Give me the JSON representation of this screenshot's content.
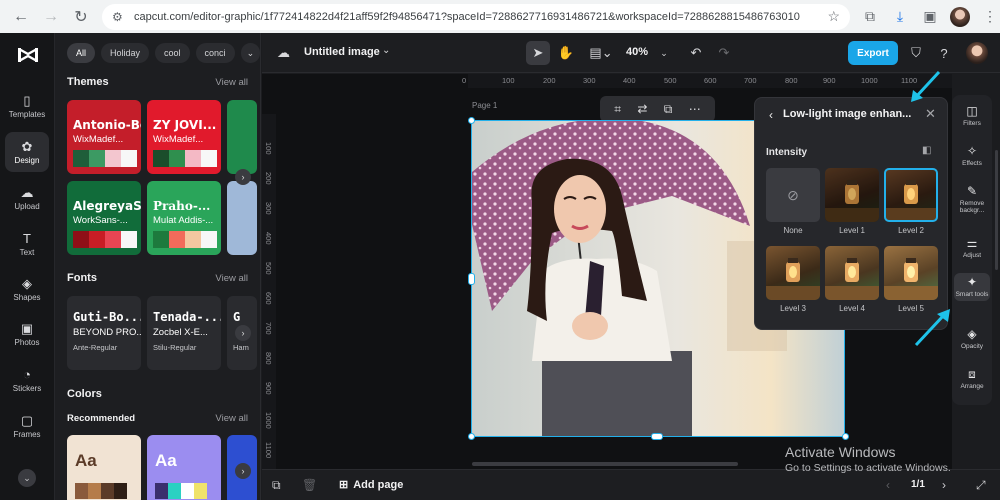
{
  "browser": {
    "url": "capcut.com/editor-graphic/1f772414822d4f21aff59f2f94856471?spaceId=7288627716931486721&workspaceId=7288628815486763010"
  },
  "left_rail": {
    "items": [
      {
        "label": "Templates",
        "icon": "templates-icon"
      },
      {
        "label": "Design",
        "icon": "design-icon"
      },
      {
        "label": "Upload",
        "icon": "upload-icon"
      },
      {
        "label": "Text",
        "icon": "text-icon"
      },
      {
        "label": "Shapes",
        "icon": "shapes-icon"
      },
      {
        "label": "Photos",
        "icon": "photos-icon"
      },
      {
        "label": "Stickers",
        "icon": "stickers-icon"
      },
      {
        "label": "Frames",
        "icon": "frames-icon"
      }
    ],
    "active": "Design"
  },
  "panel": {
    "chips": [
      "All",
      "Holiday",
      "cool",
      "conci"
    ],
    "themes": {
      "title": "Themes",
      "view_all": "View all",
      "cards": [
        {
          "t1": "Antonio-Bold",
          "t2": "WixMadef...",
          "bg": "#c41e2a",
          "swatches": [
            "#1f5e3a",
            "#3c9a63",
            "#f3c6cf",
            "#f7f7f7"
          ]
        },
        {
          "t1": "ZY JOVI...",
          "t2": "WixMadef...",
          "bg": "#e11a2c",
          "swatches": [
            "#1b4d2b",
            "#2f8f4e",
            "#f4b9c5",
            "#f7f7f7"
          ]
        },
        {
          "t1": "AlegreyaS...",
          "t2": "WorkSans-...",
          "bg": "#116c3a",
          "swatches": [
            "#8f0f17",
            "#c81d25",
            "#e84553",
            "#f7f7f7"
          ]
        },
        {
          "t1": "Praho-...",
          "t2": "Mulat Addis-...",
          "bg": "#2aa55a",
          "swatches": [
            "#1d7a3d",
            "#f26b5b",
            "#f4c7a0",
            "#f7f7f7"
          ]
        }
      ]
    },
    "fonts": {
      "title": "Fonts",
      "view_all": "View all",
      "cards": [
        {
          "f1": "Guti-Bo...",
          "f2": "BEYOND PRO...",
          "f3": "Ante-Regular"
        },
        {
          "f1": "Tenada-...",
          "f2": "Zocbel X-E...",
          "f3": "Stilu-Regular"
        },
        {
          "f1": "G",
          "f2": "",
          "f3": "Ham"
        }
      ]
    },
    "colors": {
      "title": "Colors",
      "recommended": "Recommended",
      "view_all": "View all",
      "cards": [
        {
          "aa": "Aa",
          "bg": "#f1e3d3",
          "fg": "#5b3b28",
          "swatches": [
            "#8a5a3c",
            "#b57c4a",
            "#5b3b28",
            "#2e1e15"
          ]
        },
        {
          "aa": "Aa",
          "bg": "#9b8df0",
          "fg": "#ffffff",
          "swatches": [
            "#3a2f6d",
            "#2ad1c2",
            "#ffffff",
            "#f0e36a"
          ]
        }
      ]
    }
  },
  "topbar": {
    "title": "Untitled image",
    "zoom": "40%",
    "export": "Export"
  },
  "canvas": {
    "page_label": "Page 1",
    "ruler_top": [
      "100",
      "200",
      "300",
      "400",
      "500",
      "600",
      "700",
      "800",
      "900",
      "1000",
      "1100"
    ],
    "ruler_left": [
      "100",
      "200",
      "300",
      "400",
      "500",
      "600",
      "700",
      "800",
      "900",
      "1000",
      "1100"
    ]
  },
  "popup": {
    "title": "Low-light image enhan...",
    "intensity": "Intensity",
    "levels": [
      "None",
      "Level 1",
      "Level 2",
      "Level 3",
      "Level 4",
      "Level 5"
    ],
    "selected": "Level 2"
  },
  "tools": [
    {
      "label": "Filters",
      "icon": "filters-icon"
    },
    {
      "label": "Effects",
      "icon": "effects-icon"
    },
    {
      "label": "Remove backgr...",
      "icon": "remove-background-icon"
    },
    {
      "label": "Adjust",
      "icon": "adjust-icon"
    },
    {
      "label": "Smart tools",
      "icon": "smart-tools-icon"
    },
    {
      "label": "Opacity",
      "icon": "opacity-icon"
    },
    {
      "label": "Arrange",
      "icon": "arrange-icon"
    }
  ],
  "bottombar": {
    "add_page": "Add page",
    "pager": "1/1"
  },
  "watermark": {
    "line1": "Activate Windows",
    "line2": "Go to Settings to activate Windows."
  },
  "colors": {
    "accent": "#1aa6e8",
    "annotation_arrow": "#1ec3ea"
  }
}
